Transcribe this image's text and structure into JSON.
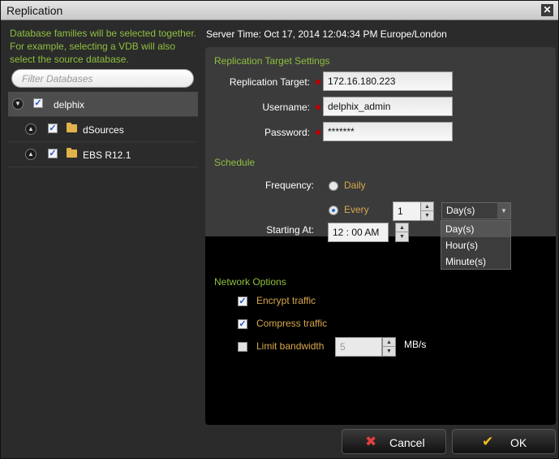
{
  "window": {
    "title": "Replication",
    "close_glyph": "✕"
  },
  "left": {
    "hint": "Database families will be selected together. For example, selecting a VDB will also select the source database.",
    "filter_placeholder": "Filter Databases",
    "tree": [
      {
        "label": "delphix",
        "checked": true,
        "expanded": true,
        "icon": "none"
      },
      {
        "label": "dSources",
        "checked": true,
        "expanded": false,
        "icon": "folder-icon"
      },
      {
        "label": "EBS R12.1",
        "checked": true,
        "expanded": false,
        "icon": "folder-icon"
      }
    ]
  },
  "server_time": "Server Time: Oct 17, 2014 12:04:34 PM Europe/London",
  "target": {
    "heading": "Replication Target Settings",
    "target_label": "Replication Target:",
    "target_value": "172.16.180.223",
    "username_label": "Username:",
    "username_value": "delphix_admin",
    "password_label": "Password:",
    "password_value": "*******"
  },
  "schedule": {
    "heading": "Schedule",
    "frequency_label": "Frequency:",
    "daily_label": "Daily",
    "every_label": "Every",
    "selected": "Every",
    "every_value": "1",
    "unit_selected": "Day(s)",
    "unit_options": [
      "Day(s)",
      "Hour(s)",
      "Minute(s)"
    ],
    "starting_label": "Starting At:",
    "starting_value": "12 : 00 AM"
  },
  "network": {
    "heading": "Network Options",
    "encrypt_label": "Encrypt traffic",
    "encrypt_checked": true,
    "compress_label": "Compress traffic",
    "compress_checked": true,
    "limit_label": "Limit bandwidth",
    "limit_checked": false,
    "limit_value": "5",
    "limit_unit": "MB/s"
  },
  "buttons": {
    "cancel": "Cancel",
    "ok": "OK"
  },
  "colors": {
    "section_green": "#8fbf3f",
    "option_orange": "#d7a84c",
    "required_red": "#bb0000",
    "cancel_red": "#e04040",
    "ok_yellow": "#f0c020"
  }
}
